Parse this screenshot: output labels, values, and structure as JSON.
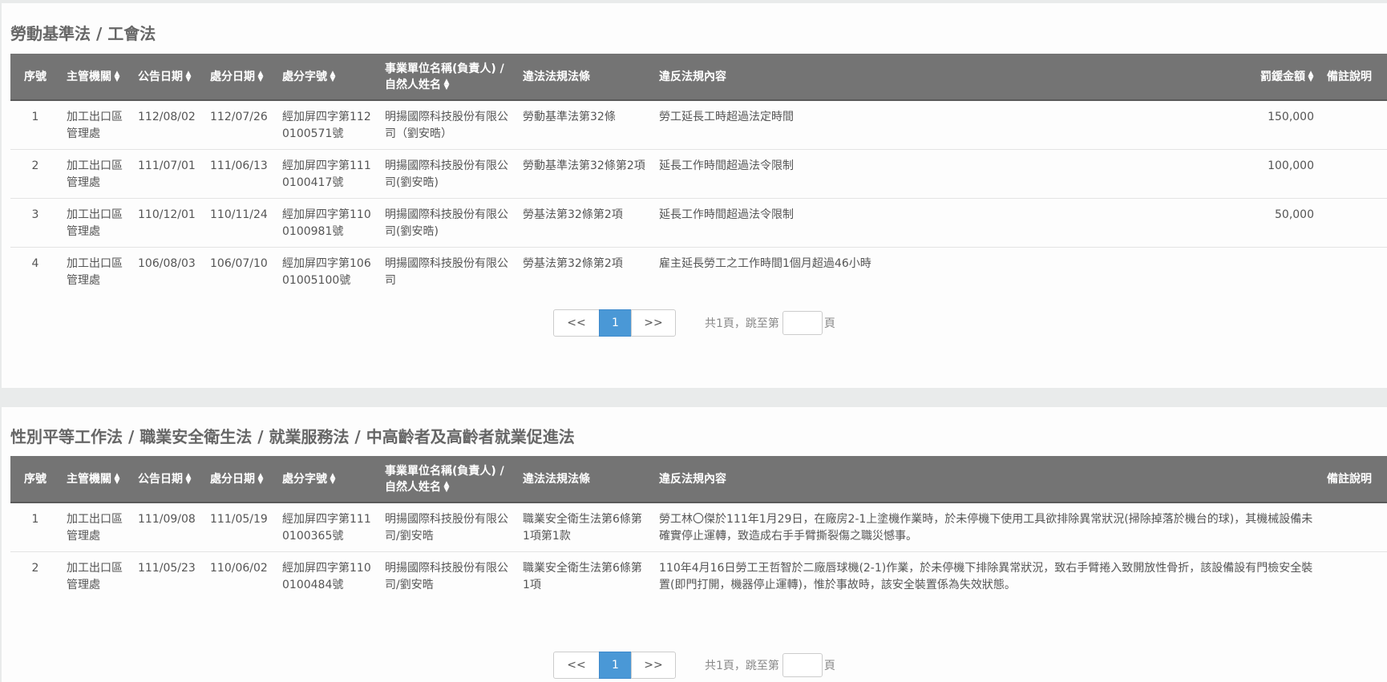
{
  "sections": [
    {
      "title": "勞動基準法 / 工會法",
      "headers": {
        "no": "序號",
        "agency": "主管機關",
        "announce_date": "公告日期",
        "penalty_date": "處分日期",
        "penalty_no": "處分字號",
        "entity": "事業單位名稱(負責人) / 自然人姓名",
        "law": "違法法規法條",
        "content": "違反法規內容",
        "fine": "罰鍰金額",
        "remark": "備註說明"
      },
      "rows": [
        {
          "no": "1",
          "agency": "加工出口區管理處",
          "announce_date": "112/08/02",
          "penalty_date": "112/07/26",
          "penalty_no": "經加屏四字第1120100571號",
          "entity": "明揚國際科技股份有限公司（劉安晧）",
          "law": "勞動基準法第32條",
          "content": "勞工延長工時超過法定時間",
          "fine": "150,000",
          "remark": ""
        },
        {
          "no": "2",
          "agency": "加工出口區管理處",
          "announce_date": "111/07/01",
          "penalty_date": "111/06/13",
          "penalty_no": "經加屏四字第1110100417號",
          "entity": "明揚國際科技股份有限公司(劉安晧)",
          "law": "勞動基準法第32條第2項",
          "content": "延長工作時間超過法令限制",
          "fine": "100,000",
          "remark": ""
        },
        {
          "no": "3",
          "agency": "加工出口區管理處",
          "announce_date": "110/12/01",
          "penalty_date": "110/11/24",
          "penalty_no": "經加屏四字第1100100981號",
          "entity": "明揚國際科技股份有限公司(劉安晧)",
          "law": "勞基法第32條第2項",
          "content": "延長工作時間超過法令限制",
          "fine": "50,000",
          "remark": ""
        },
        {
          "no": "4",
          "agency": "加工出口區管理處",
          "announce_date": "106/08/03",
          "penalty_date": "106/07/10",
          "penalty_no": "經加屏四字第10601005100號",
          "entity": "明揚國際科技股份有限公司",
          "law": "勞基法第32條第2項",
          "content": "雇主延長勞工之工作時間1個月超過46小時",
          "fine": "",
          "remark": ""
        }
      ],
      "pagination": {
        "prev": "<<",
        "current": "1",
        "next": ">>",
        "info": "共1頁，跳至第",
        "suffix": "頁"
      }
    },
    {
      "title": "性別平等工作法 / 職業安全衛生法 / 就業服務法 / 中高齡者及高齡者就業促進法",
      "headers": {
        "no": "序號",
        "agency": "主管機關",
        "announce_date": "公告日期",
        "penalty_date": "處分日期",
        "penalty_no": "處分字號",
        "entity": "事業單位名稱(負責人) / 自然人姓名",
        "law": "違法法規法條",
        "content": "違反法規內容",
        "remark": "備註說明"
      },
      "rows": [
        {
          "no": "1",
          "agency": "加工出口區管理處",
          "announce_date": "111/09/08",
          "penalty_date": "111/05/19",
          "penalty_no": "經加屏四字第1110100365號",
          "entity": "明揚國際科技股份有限公司/劉安晧",
          "law": "職業安全衛生法第6條第1項第1款",
          "content": "勞工林〇傑於111年1月29日，在廠房2-1上塗機作業時，於未停機下使用工具欲排除異常狀況(掃除掉落於機台的球)，其機械設備未確實停止運轉，致造成右手手臂撕裂傷之職災憾事。",
          "remark": ""
        },
        {
          "no": "2",
          "agency": "加工出口區管理處",
          "announce_date": "111/05/23",
          "penalty_date": "110/06/02",
          "penalty_no": "經加屏四字第1100100484號",
          "entity": "明揚國際科技股份有限公司/劉安晧",
          "law": "職業安全衛生法第6條第1項",
          "content": "110年4月16日勞工王哲智於二廠唇球機(2-1)作業，於未停機下排除異常狀況，致右手臂捲入致開放性骨折，該設備設有門檢安全裝置(即門打開，機器停止運轉)，惟於事故時，該安全裝置係為失效狀態。",
          "remark": ""
        }
      ],
      "pagination": {
        "prev": "<<",
        "current": "1",
        "next": ">>",
        "info": "共1頁，跳至第",
        "suffix": "頁"
      }
    }
  ],
  "icons": {
    "sort": "sort-icon"
  }
}
